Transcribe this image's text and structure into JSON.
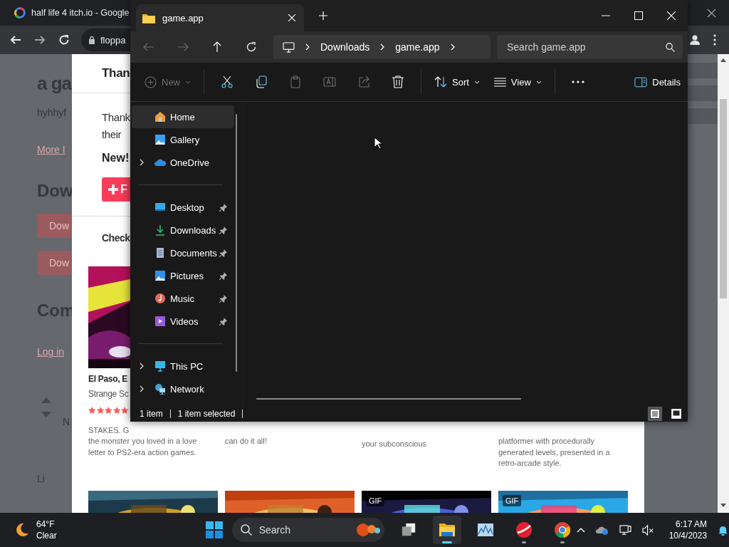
{
  "browser": {
    "tab_title": "half life 4 itch.io - Google",
    "address": "floppa",
    "page": {
      "left_items": [
        {
          "kind": "title",
          "text": "a ga"
        },
        {
          "kind": "text",
          "text": "hyhhyf"
        },
        {
          "kind": "link",
          "text": "More I"
        },
        {
          "kind": "heading",
          "text": "Dow"
        },
        {
          "kind": "button",
          "text": "Dow"
        },
        {
          "kind": "button",
          "text": "Dow"
        },
        {
          "kind": "heading",
          "text": "Com"
        },
        {
          "kind": "link",
          "text": "Log in"
        },
        {
          "kind": "vote",
          "text": "N"
        },
        {
          "kind": "text",
          "text": "Li"
        }
      ],
      "modal": {
        "title": "Than",
        "paragraph": [
          "Thank",
          "their"
        ],
        "note": "New!",
        "button": "F",
        "section_title": "Check",
        "games": [
          {
            "title": "El Paso, E",
            "author": "Strange Sc",
            "stars": 5,
            "description": [
              "STAKES. G",
              "the monster you loved in a love",
              "letter to PS2-era action games."
            ]
          },
          {
            "description": [
              "can do it all!"
            ]
          },
          {
            "description": [
              "your subconscious"
            ]
          },
          {
            "description": [
              "platformer with procedurally",
              "generated levels, presented in a",
              "retro-arcade style."
            ]
          }
        ],
        "more_games": [
          {
            "kind": "picture"
          },
          {
            "kind": "picture"
          },
          {
            "kind": "picture",
            "badge": "GIF"
          },
          {
            "kind": "picture",
            "badge": "GIF"
          }
        ]
      }
    }
  },
  "explorer": {
    "tab": {
      "title": "game.app",
      "selected": true
    },
    "nav": [
      {
        "kind": "back",
        "disabled": true
      },
      {
        "kind": "forward",
        "disabled": true
      },
      {
        "kind": "up",
        "disabled": false
      },
      {
        "kind": "refresh",
        "disabled": false
      }
    ],
    "breadcrumb": [
      "Downloads",
      "game.app"
    ],
    "search": {
      "placeholder": "Search game.app"
    },
    "commands": [
      {
        "kind": "new",
        "label": "New",
        "disabled": true
      },
      {
        "kind": "separator"
      },
      {
        "kind": "cut",
        "disabled": false
      },
      {
        "kind": "copy",
        "disabled": false
      },
      {
        "kind": "paste",
        "disabled": true
      },
      {
        "kind": "rename",
        "disabled": true
      },
      {
        "kind": "share",
        "disabled": true
      },
      {
        "kind": "delete",
        "disabled": false
      },
      {
        "kind": "separator"
      },
      {
        "kind": "sort",
        "label": "Sort",
        "disabled": false
      },
      {
        "kind": "view",
        "label": "View",
        "disabled": false
      },
      {
        "kind": "separator"
      },
      {
        "kind": "more",
        "disabled": false
      }
    ],
    "details": {
      "label": "Details"
    },
    "sidebar": [
      [
        {
          "label": "Home",
          "kind": "home",
          "selected": true,
          "expandable": false,
          "pinned": false
        },
        {
          "label": "Gallery",
          "kind": "gallery",
          "selected": false,
          "expandable": false,
          "pinned": false
        },
        {
          "label": "OneDrive",
          "kind": "cloud",
          "selected": false,
          "expandable": true,
          "pinned": false
        }
      ],
      [
        {
          "label": "Desktop",
          "kind": "desktop",
          "selected": false,
          "expandable": false,
          "pinned": true
        },
        {
          "label": "Downloads",
          "kind": "download",
          "selected": false,
          "expandable": false,
          "pinned": true
        },
        {
          "label": "Documents",
          "kind": "documents",
          "selected": false,
          "expandable": false,
          "pinned": true
        },
        {
          "label": "Pictures",
          "kind": "pictures",
          "selected": false,
          "expandable": false,
          "pinned": true
        },
        {
          "label": "Music",
          "kind": "music",
          "selected": false,
          "expandable": false,
          "pinned": true
        },
        {
          "label": "Videos",
          "kind": "videos",
          "selected": false,
          "expandable": false,
          "pinned": true
        }
      ],
      [
        {
          "label": "This PC",
          "kind": "pc",
          "selected": false,
          "expandable": true,
          "pinned": false
        },
        {
          "label": "Network",
          "kind": "network",
          "selected": false,
          "expandable": true,
          "pinned": false
        }
      ]
    ],
    "status": {
      "count": "1 item",
      "selection": "1 item selected"
    },
    "views": [
      {
        "kind": "details",
        "selected": true
      },
      {
        "kind": "tiles",
        "selected": false
      }
    ]
  },
  "taskbar": {
    "weather": {
      "temp": "64°F",
      "condition": "Clear"
    },
    "search": {
      "placeholder": "Search"
    },
    "apps": [
      {
        "kind": "taskview",
        "running": false,
        "active": false
      },
      {
        "kind": "explorer",
        "running": true,
        "active": true
      },
      {
        "kind": "monitor",
        "running": false,
        "active": false
      },
      {
        "kind": "ball",
        "running": true,
        "active": false
      },
      {
        "kind": "chrome",
        "running": true,
        "active": false
      }
    ],
    "time": "6:17 AM",
    "date": "10/4/2023"
  }
}
